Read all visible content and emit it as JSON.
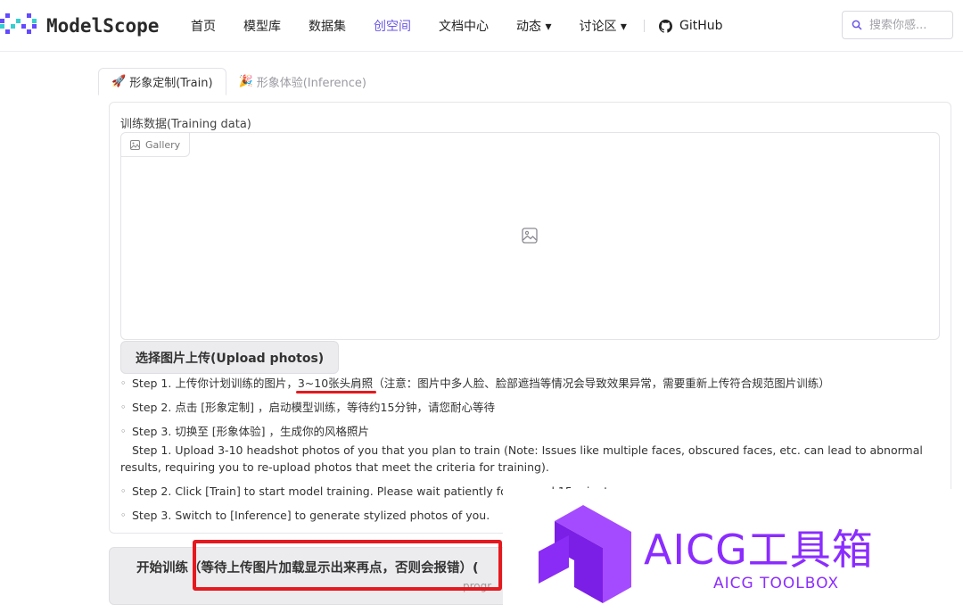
{
  "header": {
    "logo_text": "ModelScope",
    "nav": [
      "首页",
      "模型库",
      "数据集",
      "创空间",
      "文档中心",
      "动态 ▾",
      "讨论区 ▾"
    ],
    "github_label": "GitHub",
    "search_placeholder": "搜索你感..."
  },
  "tabs": {
    "train_label": "形象定制(Train)",
    "inference_label": "形象体验(Inference)"
  },
  "train_panel": {
    "field_label": "训练数据(Training data)",
    "gallery_tag": "Gallery",
    "upload_button": "选择图片上传(Upload photos)",
    "steps": {
      "s1_before": "Step 1. 上传你计划训练的图片，",
      "s1_highlight": "3~10张头肩照",
      "s1_after": "（注意：图片中多人脸、脸部遮挡等情况会导致效果异常，需要重新上传符合规范图片训练）",
      "s2": "Step 2. 点击 [形象定制] ，启动模型训练，等待约15分钟，请您耐心等待",
      "s3": "Step 3. 切换至 [形象体验] ，生成你的风格照片",
      "e1": "Step 1. Upload 3-10 headshot photos of you that you plan to train (Note: Issues like multiple faces, obscured faces, etc. can lead to abnormal results, requiring you to re-upload photos that meet the criteria for training).",
      "e2": "Step 2. Click [Train] to start model training. Please wait patiently for around 15 minutes.",
      "e3": "Step 3. Switch to [Inference] to generate stylized photos of you."
    },
    "train_button": "开始训练（等待上传图片加载显示出来再点，否则会报错）(",
    "train_button_sub": "progr"
  },
  "watermark": {
    "title": "AICG工具箱",
    "subtitle": "AICG TOOLBOX"
  },
  "colors": {
    "accent": "#6a56e5",
    "annotation_red": "#e5191e",
    "watermark_purple": "#8b2cff"
  }
}
